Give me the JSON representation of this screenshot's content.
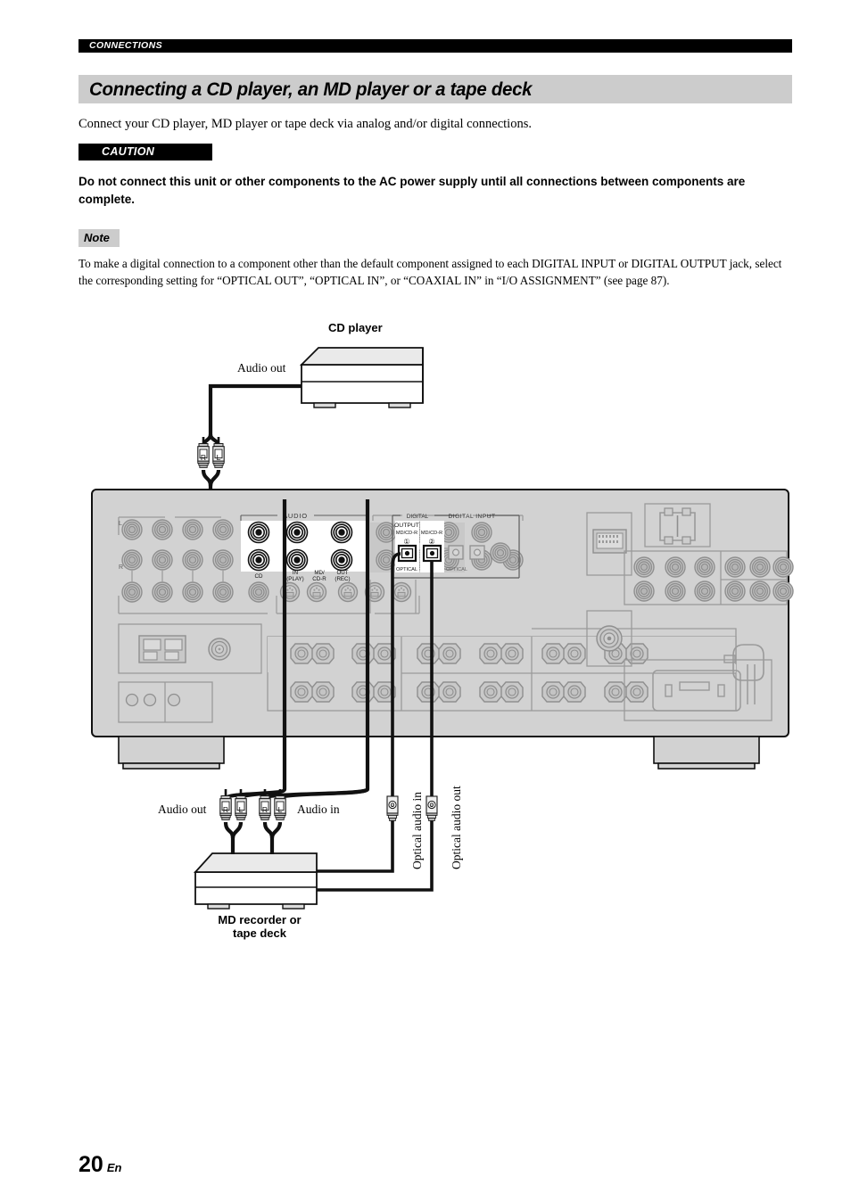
{
  "running_head": "CONNECTIONS",
  "section_title": "Connecting a CD player, an MD player or a tape deck",
  "intro": "Connect your CD player, MD player or tape deck via analog and/or digital connections.",
  "caution": {
    "chip_label": "CAUTION",
    "body": "Do not connect this unit or other components to the AC power supply until all connections between components are complete."
  },
  "note": {
    "chip_label": "Note",
    "body": "To make a digital connection to a component other than the default component assigned to each DIGITAL INPUT or DIGITAL OUTPUT jack, select the corresponding setting for “OPTICAL OUT”, “OPTICAL IN”, or “COAXIAL IN” in “I/O ASSIGNMENT” (see page 87)."
  },
  "footer": {
    "page_number": "20",
    "language": "En"
  },
  "diagram": {
    "cd_player": {
      "title": "CD player",
      "audio_out_label": "Audio out",
      "plug_right": "R",
      "plug_left": "L"
    },
    "md_recorder": {
      "title_line1": "MD recorder or",
      "title_line2": "tape deck",
      "audio_out_label": "Audio out",
      "audio_in_label": "Audio in",
      "out_plug_right": "R",
      "out_plug_left": "L",
      "in_plug_right": "R",
      "in_plug_left": "L",
      "optical_in_label": "Optical audio in",
      "optical_out_label": "Optical audio out",
      "optical_plug_glyph": "O"
    },
    "receiver": {
      "audio_group_label": "AUDIO",
      "audio_cd_label": "CD",
      "audio_in_play_line1": "IN",
      "audio_in_play_line2": "(PLAY)",
      "audio_mdcdr_line1": "MD/",
      "audio_mdcdr_line2": "CD-R",
      "audio_out_rec_line1": "OUT",
      "audio_out_rec_line2": "(REC)",
      "channel_l": "L",
      "channel_r": "R",
      "digital_group_label": "DIGITAL",
      "digital_output_label": "OUTPUT",
      "digital_output_jack": "MD/CD-R",
      "digital_output_number": "①",
      "digital_input_group_label": "DIGITAL INPUT",
      "digital_input_jack": "MD/CD-R",
      "digital_input_number": "②",
      "optical_label_out": "OPTICAL",
      "optical_label_in": "OPTICAL"
    }
  },
  "colors": {
    "runhead_bg": "#000000",
    "title_band_bg": "#cccccc",
    "note_chip_bg": "#cccccc",
    "chassis": "#d2d2d2",
    "jack_gray": "#9a9a9a",
    "highlight": "#000000",
    "plug_body": "#e8e8e8"
  }
}
